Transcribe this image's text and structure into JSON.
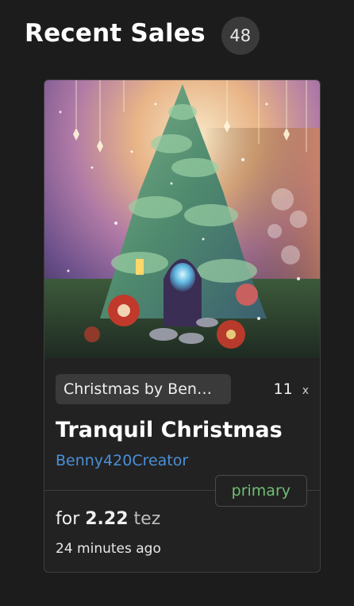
{
  "header": {
    "title": "Recent Sales",
    "count": "48"
  },
  "card": {
    "collection_label": "Christmas by Ben…",
    "edition_count": "11",
    "edition_mark": "x",
    "title": "Tranquil Christmas",
    "artist": "Benny420Creator",
    "sale_type": "primary",
    "price_prefix": "for",
    "price_amount": "2.22",
    "price_unit": "tez",
    "time_ago": "24 minutes ago"
  },
  "colors": {
    "background": "#1c1c1c",
    "card_background": "#222222",
    "link": "#4a90d9",
    "primary_badge_text": "#6fbf73"
  }
}
